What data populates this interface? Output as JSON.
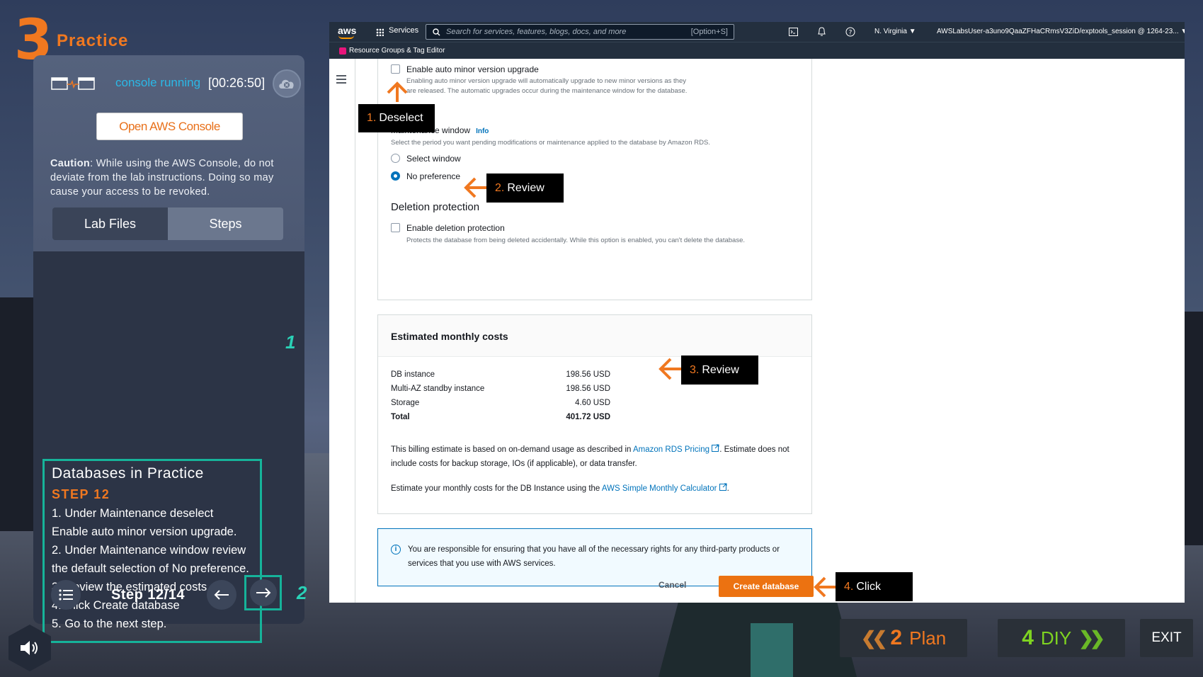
{
  "header": {
    "module_number": "3",
    "module_label": "Practice"
  },
  "console": {
    "status": "console running",
    "timer": "[00:26:50]",
    "open_button": "Open AWS Console",
    "caution_label": "Caution",
    "caution_text": ": While using the AWS Console, do not deviate from the lab instructions. Doing so may cause your access to be revoked."
  },
  "tabs": [
    {
      "label": "Lab Files"
    },
    {
      "label": "Steps"
    }
  ],
  "steps": {
    "title": "Databases in Practice",
    "step_label": "STEP 12",
    "items": [
      "1. Under Maintenance deselect Enable auto minor version upgrade.",
      "2. Under Maintenance window review the default selection of No preference.",
      "3. Review the estimated costs.",
      "4. Click Create database",
      "5. Go to the next step."
    ]
  },
  "callouts": {
    "one": "1",
    "two": "2"
  },
  "navigation": {
    "step_counter": "Step 12/14"
  },
  "aws": {
    "logo": "aws",
    "services": "Services",
    "search_placeholder": "Search for services, features, blogs, docs, and more",
    "search_shortcut": "[Option+S]",
    "region": "N. Virginia ▼",
    "account": "AWSLabsUser-a3uno9QaaZFHaCRmsV3ZiD/exptools_session @ 1264-23... ▼",
    "resource_groups": "Resource Groups & Tag Editor",
    "auto_minor": {
      "label": "Enable auto minor version upgrade",
      "desc": "Enabling auto minor version upgrade will automatically upgrade to new minor versions as they are released. The automatic upgrades occur during the maintenance window for the database."
    },
    "maintenance": {
      "label": "Maintenance window",
      "info": "Info",
      "desc": "Select the period you want pending modifications or maintenance applied to the database by Amazon RDS.",
      "option_select": "Select window",
      "option_none": "No preference"
    },
    "deletion": {
      "title": "Deletion protection",
      "label": "Enable deletion protection",
      "desc": "Protects the database from being deleted accidentally. While this option is enabled, you can't delete the database."
    },
    "costs": {
      "title": "Estimated monthly costs",
      "rows": [
        {
          "k": "DB instance",
          "v": "198.56 USD"
        },
        {
          "k": "Multi-AZ standby instance",
          "v": "198.56 USD"
        },
        {
          "k": "Storage",
          "v": "4.60 USD"
        },
        {
          "k": "Total",
          "v": "401.72 USD"
        }
      ],
      "note1_a": "This billing estimate is based on on-demand usage as described in ",
      "note1_link": "Amazon RDS Pricing",
      "note1_b": ". Estimate does not include costs for backup storage, IOs (if applicable), or data transfer.",
      "note2_a": "Estimate your monthly costs for the DB Instance using the ",
      "note2_link": "AWS Simple Monthly Calculator",
      "note2_b": "."
    },
    "alert": "You are responsible for ensuring that you have all of the necessary rights for any third-party products or services that you use with AWS services.",
    "cancel": "Cancel",
    "create": "Create database"
  },
  "annotations": [
    {
      "num": "1.",
      "text": "Deselect"
    },
    {
      "num": "2.",
      "text": "Review"
    },
    {
      "num": "3.",
      "text": "Review"
    },
    {
      "num": "4.",
      "text": "Click"
    }
  ],
  "bottom": {
    "plan_num": "2",
    "plan_label": "Plan",
    "diy_num": "4",
    "diy_label": "DIY",
    "exit_label": "EXIT"
  },
  "colors": {
    "accent_orange": "#f07820",
    "teal": "#16b39a",
    "aws_orange": "#ec7211",
    "diy_green": "#7ed321"
  }
}
